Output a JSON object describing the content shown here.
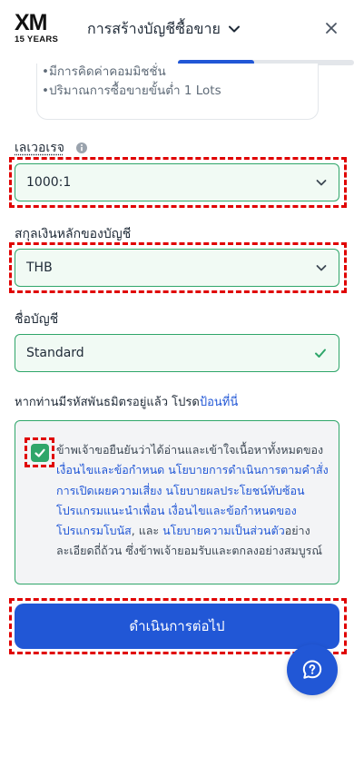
{
  "header": {
    "logo_main": "XM",
    "logo_sub": "15 YEARS",
    "title": "การสร้างบัญชีซื้อขาย",
    "icons": [
      "chevron-down-icon",
      "close-icon"
    ]
  },
  "progress": {
    "fraction": 0.25
  },
  "info_card": {
    "line1": "•มีการคิดค่าคอมมิชชั่น",
    "line2": "•ปริมาณการซื้อขายขั้นต่ำ 1 Lots"
  },
  "leverage": {
    "label": "เลเวอเรจ",
    "value": "1000:1",
    "icon": "info-icon"
  },
  "currency": {
    "label": "สกุลเงินหลักของบัญชี",
    "value": "THB"
  },
  "account_name": {
    "label": "ชื่อบัญชี",
    "value": "Standard"
  },
  "promo": {
    "text": "หากท่านมีรหัสพันธมิตรอยู่แล้ว โปรด",
    "link": "ป้อนที่นี่"
  },
  "terms": {
    "checked": true,
    "t1": "ข้าพเจ้าขอยืนยันว่าได้อ่านและเข้าใจเนื้อหาทั้งหมดของ",
    "l1": "เงื่อนไขและข้อกำหนด",
    "t2": " ",
    "l2": "นโยบายการดำเนินการตามคำสั่ง",
    "t3": " ",
    "l3": "การเปิดเผยความเสี่ยง",
    "t4": " ",
    "l4": "นโยบายผลประโยชน์ทับซ้อน",
    "t5": " ",
    "l5": "โปรแกรมแนะนำเพื่อน",
    "t6": " ",
    "l6": "เงื่อนไขและข้อกำหนดของโปรแกรมโบนัส",
    "t7": ", และ ",
    "l7": "นโยบายความเป็นส่วนตัว",
    "t8": "อย่างละเอียดถี่ถ้วน ซึ่งข้าพเจ้ายอมรับและตกลงอย่างสมบูรณ์"
  },
  "continue_button": {
    "label": "ดำเนินการต่อไป"
  },
  "help": {
    "icon": "help-chat-icon"
  },
  "colors": {
    "accent": "#2157d6",
    "success": "#2fa66a",
    "highlight": "#e00000"
  }
}
